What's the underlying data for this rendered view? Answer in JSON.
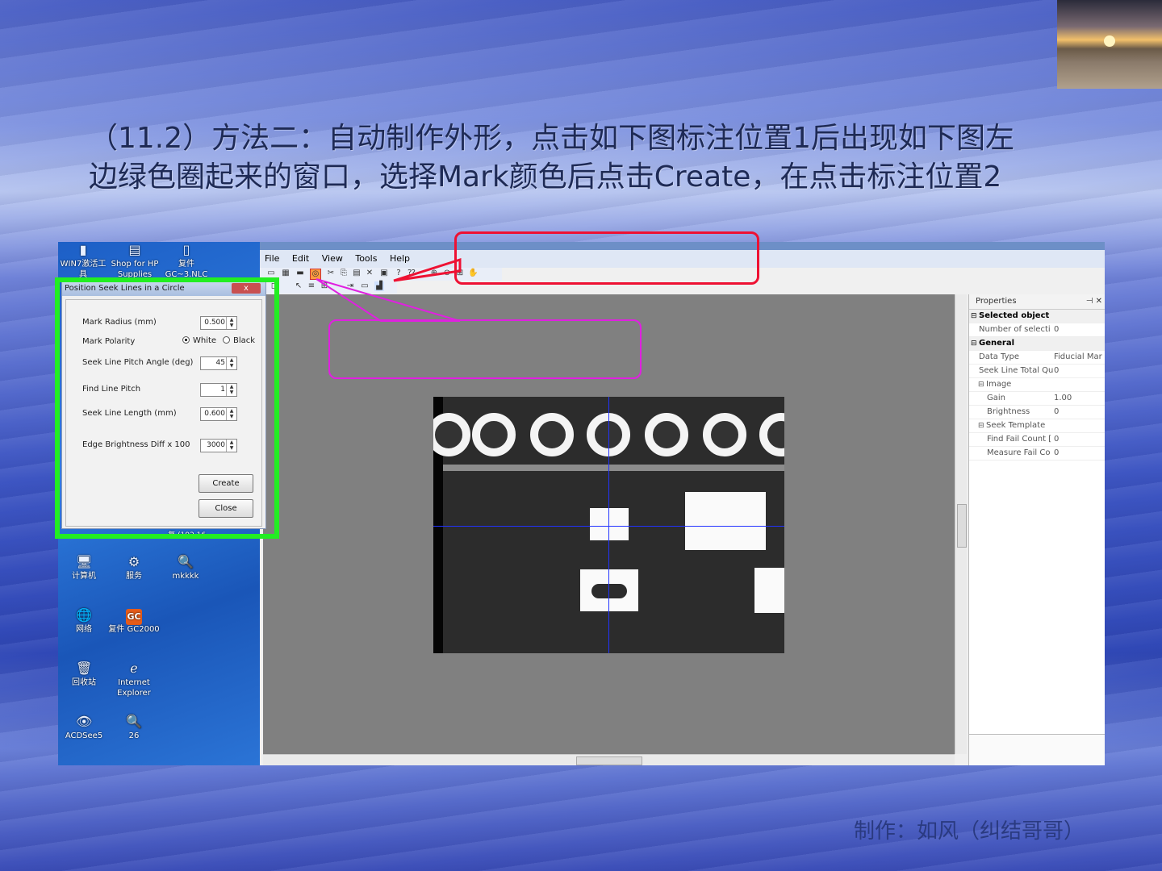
{
  "slide": {
    "heading_line1": "（11.2）方法二：自动制作外形，点击如下图标注位置1后出现如下图左",
    "heading_line2": "边绿色圈起来的窗口，选择Mark颜色后点击Create，在点击标注位置2",
    "credit": "制作：如风（纠结哥哥）",
    "accent_green": "#22ee22",
    "accent_red": "#ee1133",
    "accent_magenta": "#e020e0"
  },
  "desktop": {
    "top_icons": [
      {
        "label": "WIN7激活工具",
        "icon": "tool-icon"
      },
      {
        "label": "Shop for HP Supplies",
        "icon": "printer-icon"
      },
      {
        "label": "复件 GC~3.NLC",
        "icon": "file-icon"
      }
    ],
    "icons": [
      {
        "label": "计算机",
        "icon": "computer-icon"
      },
      {
        "label": "服务",
        "icon": "gear-icon"
      },
      {
        "label": "mkkkk",
        "icon": "magnifier-icon"
      },
      {
        "label": "网络",
        "icon": "network-icon"
      },
      {
        "label": "复件 GC2000",
        "icon": "gc-app-icon",
        "badge": "GC"
      },
      {
        "label": "回收站",
        "icon": "recycle-bin-icon"
      },
      {
        "label": "Internet Explorer",
        "icon": "ie-icon"
      },
      {
        "label": "ACDSee5",
        "icon": "eye-icon"
      },
      {
        "label": "26",
        "icon": "magnifier-icon"
      }
    ],
    "partial_label": "复 (192.16..."
  },
  "editor": {
    "menu": [
      "File",
      "Edit",
      "View",
      "Tools",
      "Help"
    ],
    "properties": {
      "title": "Properties",
      "rows": [
        {
          "type": "cat",
          "key": "Selected object"
        },
        {
          "type": "row",
          "key": "Number of selecti",
          "value": "0"
        },
        {
          "type": "cat",
          "key": "General"
        },
        {
          "type": "row",
          "key": "Data Type",
          "value": "Fiducial Mar"
        },
        {
          "type": "row",
          "key": "Seek Line Total Qu",
          "value": "0"
        },
        {
          "type": "subcat",
          "key": "Image"
        },
        {
          "type": "sub",
          "key": "Gain",
          "value": "1.00"
        },
        {
          "type": "sub",
          "key": "Brightness",
          "value": "0"
        },
        {
          "type": "subcat",
          "key": "Seek Template"
        },
        {
          "type": "sub",
          "key": "Find Fail Count [",
          "value": "0"
        },
        {
          "type": "sub",
          "key": "Measure Fail Co",
          "value": "0"
        }
      ]
    }
  },
  "dialog": {
    "title": "Position Seek Lines in a Circle",
    "close_label": "x",
    "mark_radius_label": "Mark Radius (mm)",
    "mark_radius_value": "0.500",
    "mark_polarity_label": "Mark Polarity",
    "white_label": "White",
    "black_label": "Black",
    "pitch_angle_label": "Seek Line Pitch Angle (deg)",
    "pitch_angle_value": "45",
    "find_line_pitch_label": "Find Line Pitch",
    "find_line_pitch_value": "1",
    "seek_line_length_label": "Seek Line Length (mm)",
    "seek_line_length_value": "0.600",
    "edge_brightness_label": "Edge Brightness Diff x 100",
    "edge_brightness_value": "3000",
    "create_label": "Create",
    "close_button_label": "Close"
  }
}
